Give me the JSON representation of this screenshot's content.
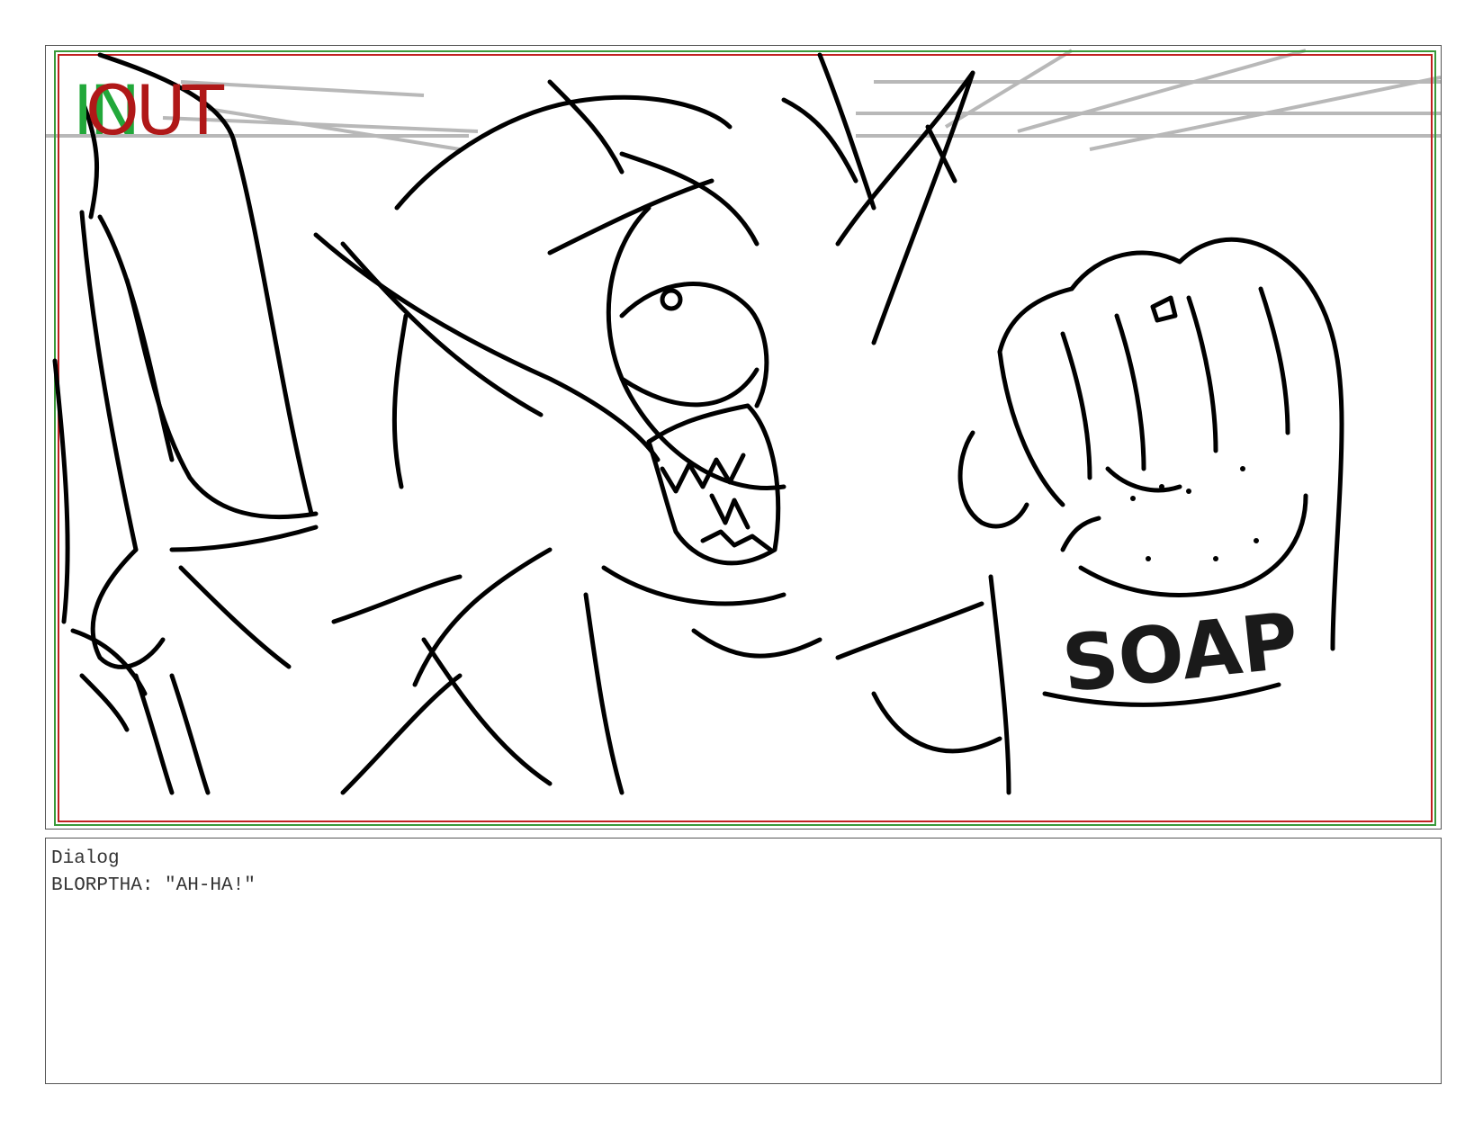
{
  "panel": {
    "marker_in": "IN",
    "marker_out": "OUT",
    "sign_text": "SOAP"
  },
  "dialog": {
    "heading": "Dialog",
    "line": "BLORPTHA: \"AH-HA!\""
  },
  "colors": {
    "in_marker": "#22a83a",
    "out_marker": "#b01818",
    "safe_area_green": "#3a9a3a",
    "safe_area_red": "#c02020",
    "guide_lines": "#b8b8b8"
  }
}
